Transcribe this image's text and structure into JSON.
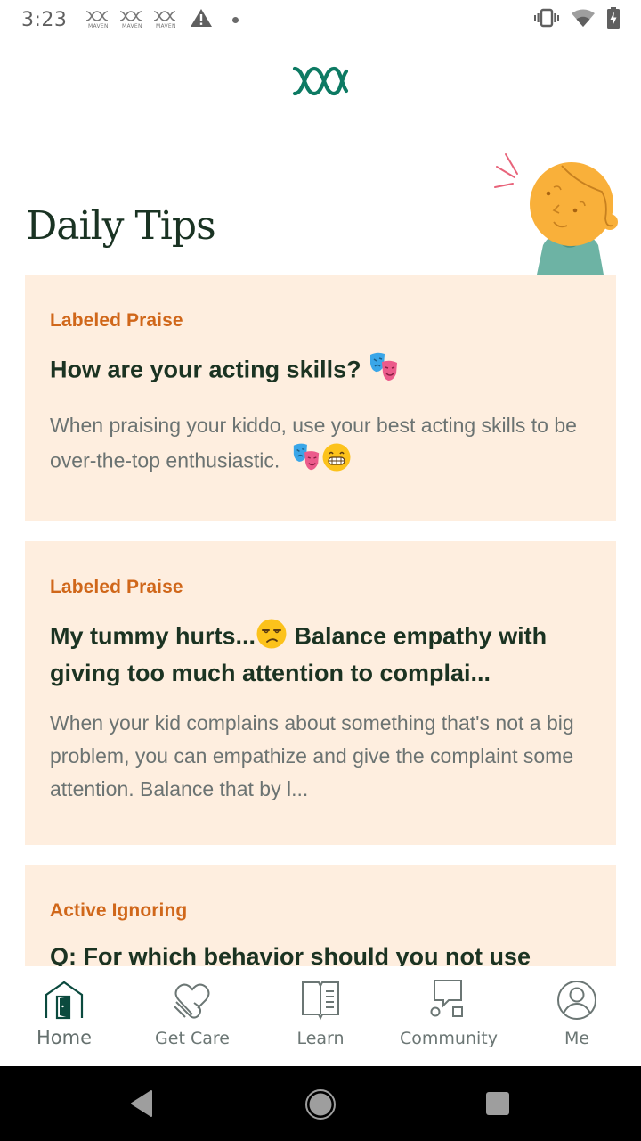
{
  "status_bar": {
    "time": "3:23",
    "notification_icons": [
      {
        "icon": "maven-logo-icon",
        "label": "MAVEN"
      },
      {
        "icon": "maven-logo-icon",
        "label": "MAVEN"
      },
      {
        "icon": "maven-logo-icon",
        "label": "MAVEN"
      },
      {
        "icon": "warning-icon"
      },
      {
        "icon": "dot-icon"
      }
    ],
    "system_icons": [
      "vibrate-icon",
      "wifi-icon",
      "battery-charging-icon"
    ]
  },
  "header": {
    "logo": "maven-logo-icon"
  },
  "page": {
    "title": "Daily Tips",
    "illustration": "child-face-illustration"
  },
  "tips": [
    {
      "category": "Labeled Praise",
      "title": "How are your acting skills?",
      "title_emoji": "🎭",
      "body": "When praising your kiddo, use your best acting skills to be over-the-top enthusiastic.",
      "body_emoji": "🎭😁"
    },
    {
      "category": "Labeled Praise",
      "title_part1": "My tummy hurts...",
      "title_emoji": "😒",
      "title_part2": " Balance empathy with giving too much attention to complai...",
      "body": "When your kid complains about something that's not a big problem, you can empathize and give the complaint some attention. Balance that by l..."
    },
    {
      "category": "Active Ignoring",
      "title": "Q: For which behavior should you not use"
    }
  ],
  "bottom_nav": {
    "active": "Home",
    "items": [
      {
        "label": "Home",
        "icon": "home-icon"
      },
      {
        "label": "Get Care",
        "icon": "heart-hand-icon"
      },
      {
        "label": "Learn",
        "icon": "book-icon"
      },
      {
        "label": "Community",
        "icon": "community-icon"
      },
      {
        "label": "Me",
        "icon": "profile-icon"
      }
    ]
  },
  "system_nav": [
    "back-button",
    "home-button",
    "recents-button"
  ],
  "colors": {
    "brand_green": "#0d7a63",
    "title_dark": "#1a3323",
    "category_orange": "#d0671a",
    "card_bg": "#feeedf",
    "body_gray": "#6b7372"
  }
}
